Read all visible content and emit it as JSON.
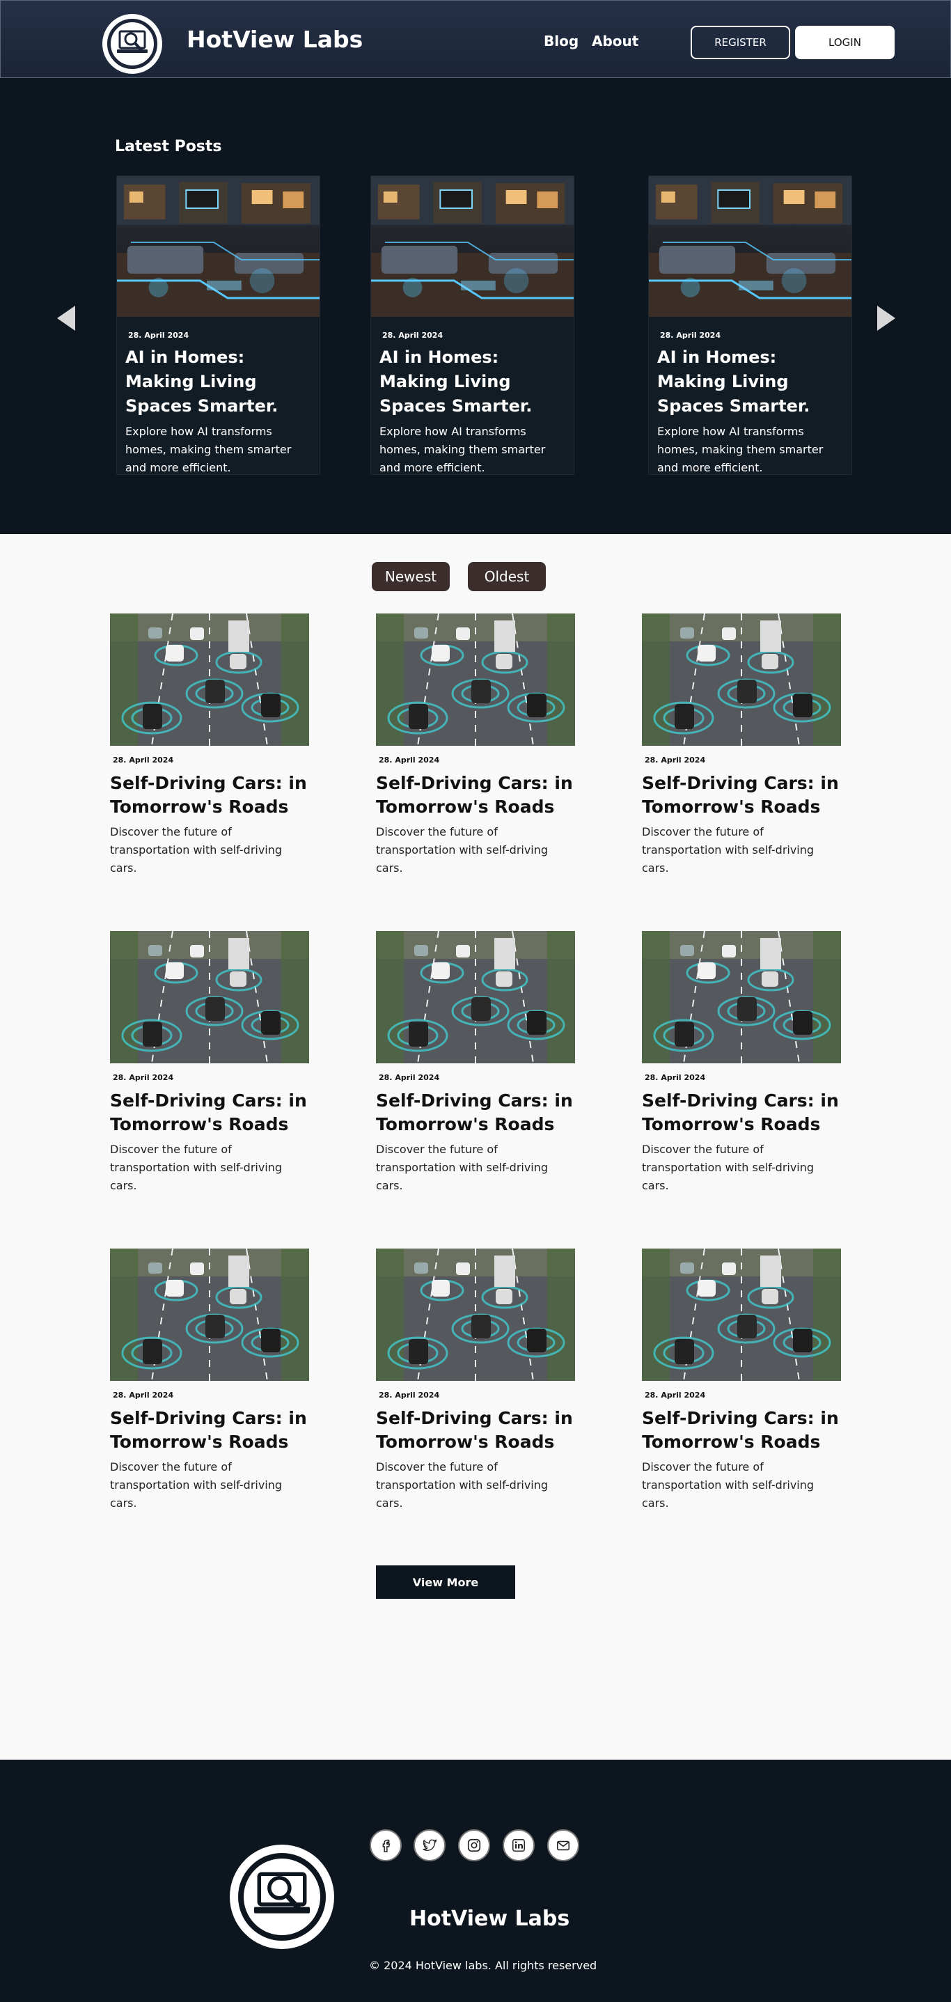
{
  "header": {
    "brand": "HotView Labs",
    "nav": [
      "Blog",
      "About"
    ],
    "register_label": "REGISTER",
    "login_label": "LOGIN"
  },
  "latest": {
    "title": "Latest Posts",
    "posts": [
      {
        "date": "28. April 2024",
        "title": "AI in Homes: Making Living Spaces Smarter.",
        "desc": "Explore how AI transforms homes, making them smarter and more efficient."
      },
      {
        "date": "28. April 2024",
        "title": "AI in Homes: Making Living Spaces Smarter.",
        "desc": "Explore how AI transforms homes, making them smarter and more efficient."
      },
      {
        "date": "28. April 2024",
        "title": "AI in Homes: Making Living Spaces Smarter.",
        "desc": "Explore how AI transforms homes, making them smarter and more efficient."
      }
    ]
  },
  "filters": {
    "newest": "Newest",
    "oldest": "Oldest"
  },
  "posts": [
    {
      "date": "28. April 2024",
      "title": "Self-Driving Cars:  in Tomorrow's Roads",
      "desc": "Discover the future of transportation with self-driving cars."
    },
    {
      "date": "28. April 2024",
      "title": "Self-Driving Cars:  in Tomorrow's Roads",
      "desc": "Discover the future of transportation with self-driving cars."
    },
    {
      "date": "28. April 2024",
      "title": "Self-Driving Cars:  in Tomorrow's Roads",
      "desc": "Discover the future of transportation with self-driving cars."
    },
    {
      "date": "28. April 2024",
      "title": "Self-Driving Cars:  in Tomorrow's Roads",
      "desc": "Discover the future of transportation with self-driving cars."
    },
    {
      "date": "28. April 2024",
      "title": "Self-Driving Cars:  in Tomorrow's Roads",
      "desc": "Discover the future of transportation with self-driving cars."
    },
    {
      "date": "28. April 2024",
      "title": "Self-Driving Cars:  in Tomorrow's Roads",
      "desc": "Discover the future of transportation with self-driving cars."
    },
    {
      "date": "28. April 2024",
      "title": "Self-Driving Cars:  in Tomorrow's Roads",
      "desc": "Discover the future of transportation with self-driving cars."
    },
    {
      "date": "28. April 2024",
      "title": "Self-Driving Cars:  in Tomorrow's Roads",
      "desc": "Discover the future of transportation with self-driving cars."
    },
    {
      "date": "28. April 2024",
      "title": "Self-Driving Cars:  in Tomorrow's Roads",
      "desc": "Discover the future of transportation with self-driving cars."
    }
  ],
  "view_more_label": "View More",
  "footer": {
    "social": [
      "facebook-icon",
      "twitter-icon",
      "instagram-icon",
      "linkedin-icon",
      "mail-icon"
    ],
    "brand": "HotView Labs",
    "copyright": "© 2024 HotView labs. All rights reserved"
  }
}
